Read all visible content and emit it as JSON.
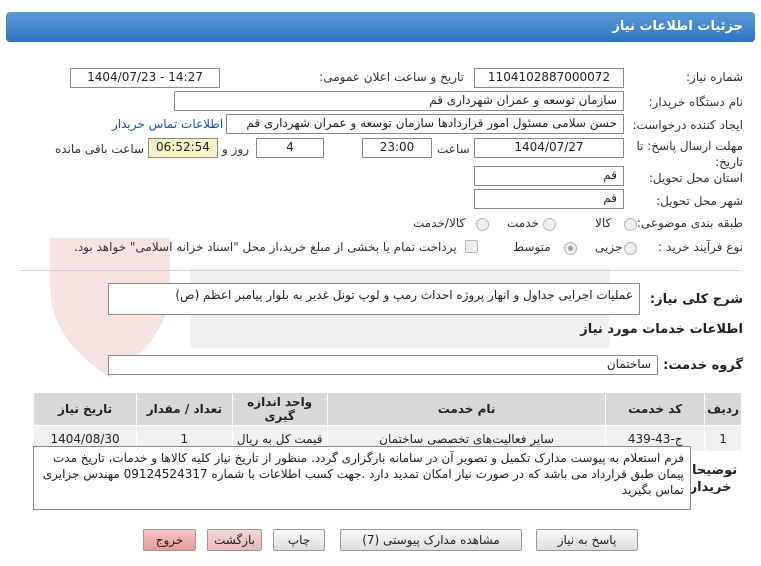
{
  "header": {
    "title": "جزئیات اطلاعات نیاز"
  },
  "form": {
    "need_number_label": "شماره نیاز:",
    "need_number": "1104102887000072",
    "announce_label": "تاریخ و ساعت اعلان عمومی:",
    "announce_value": "1404/07/23 - 14:27",
    "buyer_label": "نام دستگاه خریدار:",
    "buyer_value": "سازمان توسعه و عمران شهرداری قم",
    "creator_label": "ایجاد کننده درخواست:",
    "creator_value": "حسن سلامی مسئول امور قراردادها سازمان توسعه و عمران شهرداری قم",
    "contact_link": "اطلاعات تماس خریدار",
    "deadline_label": "مهلت ارسال پاسخ: تا تاریخ:",
    "deadline_date": "1404/07/27",
    "time_label": "ساعت",
    "deadline_time": "23:00",
    "days_value": "4",
    "days_label": "روز و",
    "remaining_time": "06:52:54",
    "remaining_label": "ساعت باقی مانده",
    "province_label": "استان محل تحویل:",
    "province_value": "قم",
    "city_label": "شهر محل تحویل:",
    "city_value": "قم",
    "category_label": "طبقه بندی موضوعی:",
    "category_options": [
      "کالا",
      "خدمت",
      "کالا/خدمت"
    ],
    "process_label": "نوع فرآیند خرید :",
    "process_options": [
      "جزیی",
      "متوسط"
    ],
    "payment_note": "پرداخت تمام یا بخشی از مبلغ خرید،از محل \"اسناد خزانه اسلامی\" خواهد بود."
  },
  "description": {
    "label": "شرح کلی نیاز:",
    "value": "عملیات اجرایی جداول و انهار پروژه احداث رمپ و لوپ تونل غدیر به بلوار پیامبر اعظم (ص)"
  },
  "services": {
    "title": "اطلاعات خدمات مورد نیاز",
    "group_label": "گروه خدمت:",
    "group_value": "ساختمان",
    "columns": [
      "ردیف",
      "کد خدمت",
      "نام خدمت",
      "واحد اندازه گیری",
      "تعداد / مقدار",
      "تاریخ نیاز"
    ],
    "rows": [
      [
        "1",
        "ج-43-439",
        "سایر فعالیت‌های تخصصی ساختمان",
        "قیمت کل به ریال",
        "1",
        "1404/08/30"
      ]
    ]
  },
  "buyer_notes": {
    "label": "توضیحات خریدار:",
    "value": "فرم استعلام به پیوست مدارک تکمیل و تصویر آن در سامانه بارگزاری گردد. منظور از تاریخ نیاز کلیه کالاها و خدمات، تاریخ مدت پیمان طبق قرارداد می باشد که در صورت نیاز امکان تمدید دارد .جهت کسب اطلاعات با شماره 09124524317 مهندس جزایری تماس بگیرید"
  },
  "buttons": {
    "reply": "پاسخ به نیاز",
    "attachments": "مشاهده مدارک پیوستی (7)",
    "print": "چاپ",
    "back": "بازگشت",
    "exit": "خروج"
  }
}
